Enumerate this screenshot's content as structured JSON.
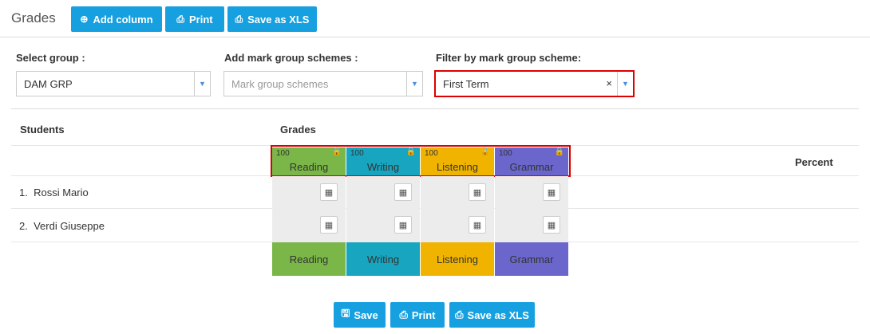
{
  "header": {
    "title": "Grades",
    "buttons": {
      "add_column": "Add column",
      "print": "Print",
      "save_xls": "Save as XLS"
    }
  },
  "filters": {
    "group": {
      "label": "Select group :",
      "value": "DAM GRP"
    },
    "schemes": {
      "label": "Add mark group schemes :",
      "placeholder": "Mark group schemes"
    },
    "filter": {
      "label": "Filter by mark group scheme:",
      "value": "First Term",
      "clear": "×"
    }
  },
  "table": {
    "students_header": "Students",
    "grades_header": "Grades",
    "percent_header": "Percent",
    "columns": [
      {
        "name": "Reading",
        "max": "100",
        "color": "#7ab648"
      },
      {
        "name": "Writing",
        "max": "100",
        "color": "#17a5bf"
      },
      {
        "name": "Listening",
        "max": "100",
        "color": "#f0b400"
      },
      {
        "name": "Grammar",
        "max": "100",
        "color": "#6a66cc"
      }
    ],
    "students": [
      {
        "num": "1.",
        "name": "Rossi Mario"
      },
      {
        "num": "2.",
        "name": "Verdi Giuseppe"
      }
    ]
  },
  "footer": {
    "save": "Save",
    "print": "Print",
    "save_xls": "Save as XLS"
  },
  "icons": {
    "add": "plus-circle-icon",
    "print": "printer-icon",
    "lock": "lock-icon",
    "calendar": "calendar-icon",
    "save": "floppy-icon"
  }
}
